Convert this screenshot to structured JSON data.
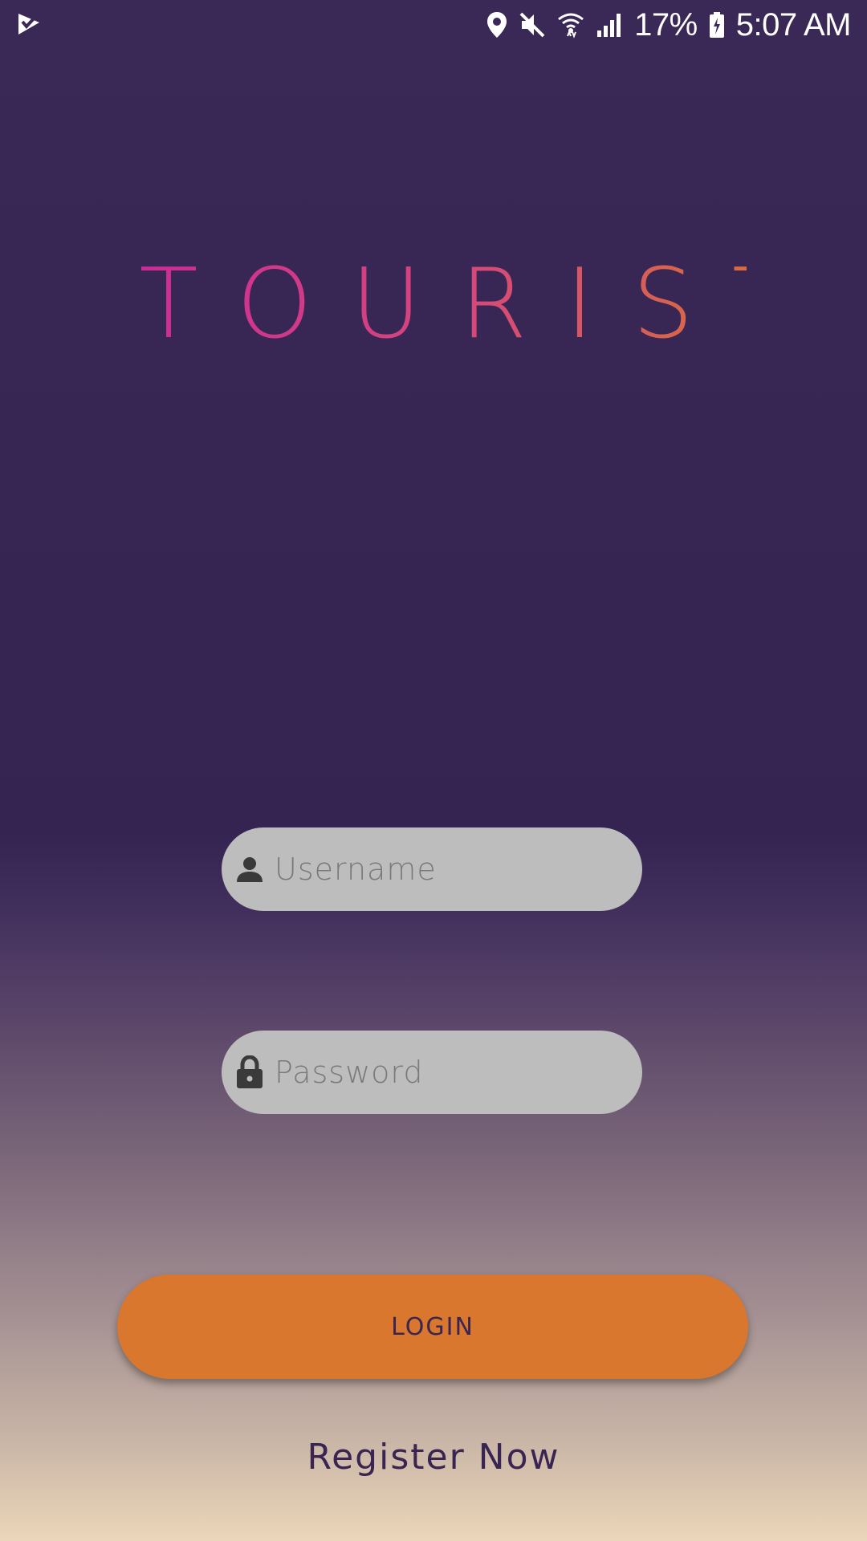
{
  "status_bar": {
    "battery_percent": "17%",
    "time": "5:07 AM",
    "icons": [
      "app-notification-icon",
      "location-icon",
      "mute-icon",
      "wifi-icon",
      "signal-icon",
      "battery-charging-icon"
    ]
  },
  "logo": {
    "text": "BTOURIST",
    "gradient": [
      "#c9239e",
      "#d8772d"
    ]
  },
  "login_form": {
    "username_placeholder": "Username",
    "password_placeholder": "Password",
    "login_label": "LOGIN",
    "register_label": "Register Now"
  },
  "colors": {
    "background_top": "#372553",
    "background_bottom": "#ebd6b9",
    "field_background": "#bdbdbd",
    "accent": "#d8772d",
    "text_dark": "#3a2552"
  }
}
